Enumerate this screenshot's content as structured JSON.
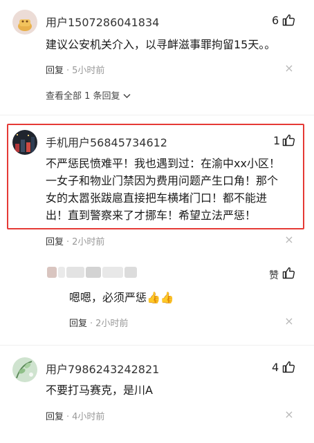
{
  "comments": [
    {
      "username": "用户1507286041834",
      "like_count": "6",
      "text": "建议公安机关介入，以寻衅滋事罪拘留15天。。",
      "reply_label": "回复",
      "separator": "·",
      "time": "5小时前",
      "close": "×",
      "expand_label": "查看全部 1 条回复",
      "expand_chevron": "⌄"
    },
    {
      "username": "手机用户56845734612",
      "like_count": "1",
      "text_lines": [
        "不严惩民愤难平！我也遇到过：在渝中xx小区！",
        "一女子和物业门禁因为费用问题产生口角！那个",
        "女的太嚣张跋扈直接把车横堵门口！都不能进",
        "出！直到警察来了才挪车！希望立法严惩！"
      ],
      "reply_label": "回复",
      "separator": "·",
      "time": "2小时前",
      "close": "×",
      "highlight_color": "#e53935"
    },
    {
      "username_blurred": true,
      "like_label": "赞",
      "text": "嗯嗯，必须严惩👍👍",
      "reply_label": "回复",
      "separator": "·",
      "time": "2小时前",
      "close": "×"
    },
    {
      "username": "用户7986243242821",
      "like_count": "4",
      "text": "不要打马赛克，是川A",
      "reply_label": "回复",
      "separator": "·",
      "time": "4小时前",
      "close": "×"
    }
  ],
  "icons": {
    "like": "thumbs-up-icon",
    "close": "close-icon",
    "chevron": "chevron-down-icon"
  }
}
